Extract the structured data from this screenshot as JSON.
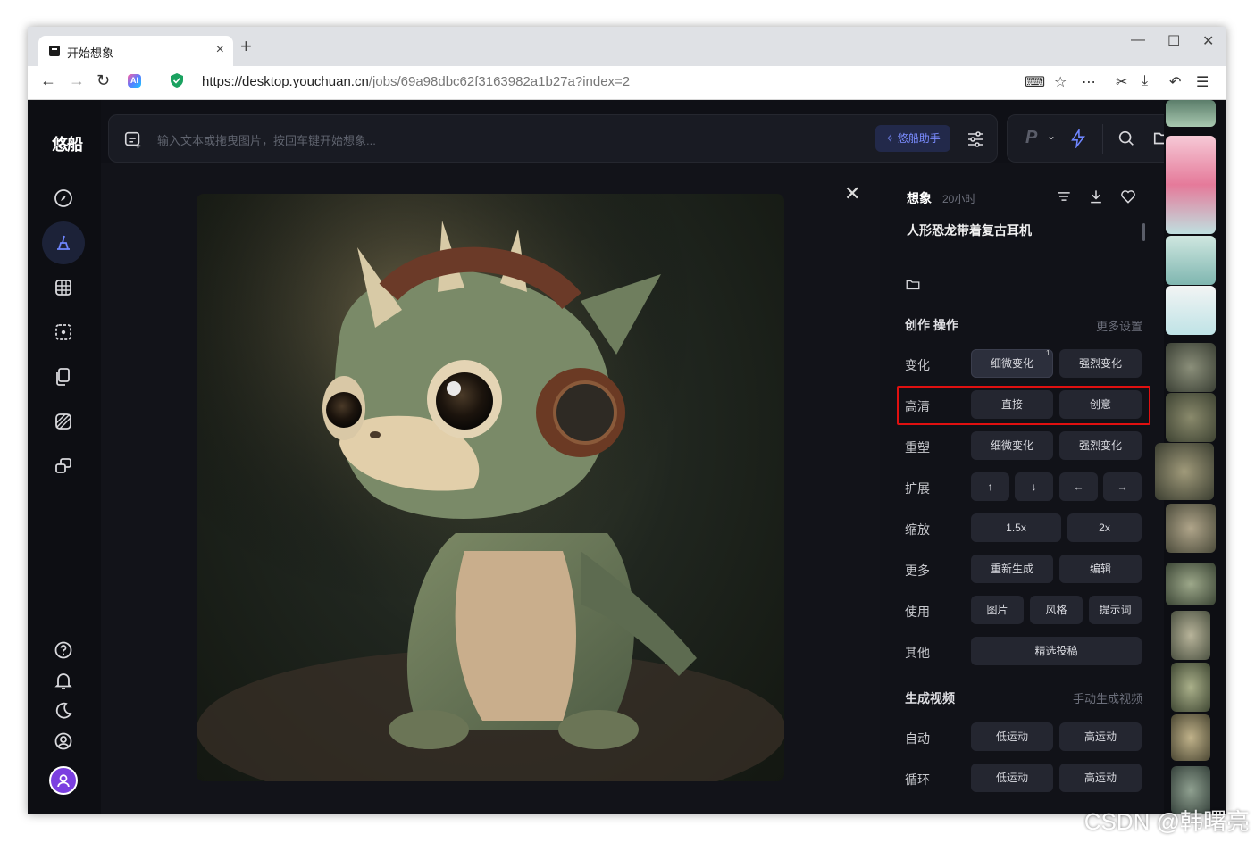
{
  "browser": {
    "tab_title": "开始想象",
    "tab_close": "×",
    "new_tab": "+",
    "url_host": "https://desktop.youchuan.cn",
    "url_path": "/jobs/69a98dbc62f3163982a1b27a?index=2",
    "window_controls": {
      "minimize": "—",
      "maximize": "☐",
      "close": "✕"
    }
  },
  "app": {
    "logo": "悠船",
    "search_placeholder": "输入文本或拖曳图片，按回车键开始想象...",
    "helper_label": "悠船助手",
    "mode_letter": "P"
  },
  "detail": {
    "section": "想象",
    "time": "20小时",
    "prompt": "人形恐龙带着复古耳机",
    "ops_title": "创作 操作",
    "more_settings": "更多设置",
    "rows": [
      {
        "label": "变化",
        "buttons": [
          "细微变化",
          "强烈变化"
        ],
        "badge": "1"
      },
      {
        "label": "高清",
        "buttons": [
          "直接",
          "创意"
        ]
      },
      {
        "label": "重塑",
        "buttons": [
          "细微变化",
          "强烈变化"
        ]
      },
      {
        "label": "扩展",
        "buttons": [
          "↑",
          "↓",
          "←",
          "→"
        ]
      },
      {
        "label": "缩放",
        "buttons": [
          "1.5x",
          "2x"
        ]
      },
      {
        "label": "更多",
        "buttons": [
          "重新生成",
          "编辑"
        ]
      },
      {
        "label": "使用",
        "buttons": [
          "图片",
          "风格",
          "提示词"
        ]
      },
      {
        "label": "其他",
        "buttons": [
          "精选投稿"
        ]
      }
    ],
    "video_title": "生成视频",
    "video_manual": "手动生成视频",
    "video_rows": [
      {
        "label": "自动",
        "buttons": [
          "低运动",
          "高运动"
        ]
      },
      {
        "label": "循环",
        "buttons": [
          "低运动",
          "高运动"
        ]
      }
    ]
  },
  "watermark": "CSDN @韩曙亮",
  "colors": {
    "accent": "#7a8cff",
    "highlight_box": "#e01010",
    "bg": "#0f1016"
  }
}
